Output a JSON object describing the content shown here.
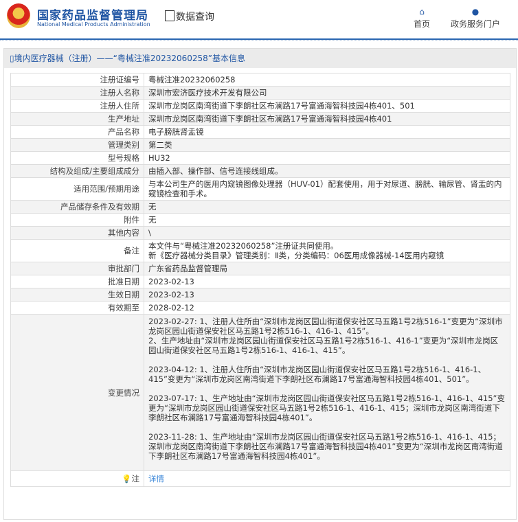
{
  "header": {
    "logo_cn": "国家药品监督管理局",
    "logo_en": "National Medical Products Administration",
    "section": "数据查询",
    "nav": [
      {
        "label": "首页",
        "icon": "home-icon"
      },
      {
        "label": "政务服务门户",
        "icon": "user-icon"
      }
    ]
  },
  "title": "境内医疗器械（注册）——“粤械注准20232060258”基本信息",
  "rows": [
    {
      "label": "注册证编号",
      "value": "粤械注准20232060258"
    },
    {
      "label": "注册人名称",
      "value": "深圳市宏济医疗技术开发有限公司"
    },
    {
      "label": "注册人住所",
      "value": "深圳市龙岗区南湾街道下李朗社区布澜路17号富通海智科技园4栋401、501"
    },
    {
      "label": "生产地址",
      "value": "深圳市龙岗区南湾街道下李朗社区布澜路17号富通海智科技园4栋401"
    },
    {
      "label": "产品名称",
      "value": "电子膀胱肾盂镜"
    },
    {
      "label": "管理类别",
      "value": "第二类"
    },
    {
      "label": "型号规格",
      "value": "HU32"
    },
    {
      "label": "结构及组成/主要组成成分",
      "value": "由插入部、操作部、信号连接线组成。"
    },
    {
      "label": "适用范围/预期用途",
      "value": "与本公司生产的医用内窥镜图像处理器（HUV-01）配套使用，用于对尿道、膀胱、输尿管、肾盂的内窥镜检查和手术。"
    },
    {
      "label": "产品储存条件及有效期",
      "value": "无"
    },
    {
      "label": "附件",
      "value": "无"
    },
    {
      "label": "其他内容",
      "value": "\\"
    },
    {
      "label": "备注",
      "value": "本文件与“粤械注准20232060258”注册证共同使用。\n新《医疗器械分类目录》管理类别：Ⅱ类，分类编码：06医用成像器械-14医用内窥镜"
    },
    {
      "label": "审批部门",
      "value": "广东省药品监督管理局"
    },
    {
      "label": "批准日期",
      "value": "2023-02-13"
    },
    {
      "label": "生效日期",
      "value": "2023-02-13"
    },
    {
      "label": "有效期至",
      "value": "2028-02-12"
    },
    {
      "label": "变更情况",
      "value": "2023-02-27: 1、注册人住所由“深圳市龙岗区园山街道保安社区马五路1号2栋516-1”变更为“深圳市龙岗区园山街道保安社区马五路1号2栋516-1、416-1、415”。\n2、生产地址由“深圳市龙岗区园山街道保安社区马五路1号2栋516-1、416-1”变更为“深圳市龙岗区园山街道保安社区马五路1号2栋516-1、416-1、415”。\n\n2023-04-12: 1、注册人住所由“深圳市龙岗区园山街道保安社区马五路1号2栋516-1、416-1、415”变更为“深圳市龙岗区南湾街道下李朗社区布澜路17号富通海智科技园4栋401、501”。\n\n2023-07-17: 1、生产地址由“深圳市龙岗区园山街道保安社区马五路1号2栋516-1、416-1、415”变更为“深圳市龙岗区园山街道保安社区马五路1号2栋516-1、416-1、415；深圳市龙岗区南湾街道下李朗社区布澜路17号富通海智科技园4栋401”。\n\n2023-11-28: 1、生产地址由“深圳市龙岗区园山街道保安社区马五路1号2栋516-1、416-1、415；深圳市龙岗区南湾街道下李朗社区布澜路17号富通海智科技园4栋401”变更为“深圳市龙岗区南湾街道下李朗社区布澜路17号富通海智科技园4栋401”。"
    }
  ],
  "note": {
    "label": "注",
    "link": "详情"
  }
}
